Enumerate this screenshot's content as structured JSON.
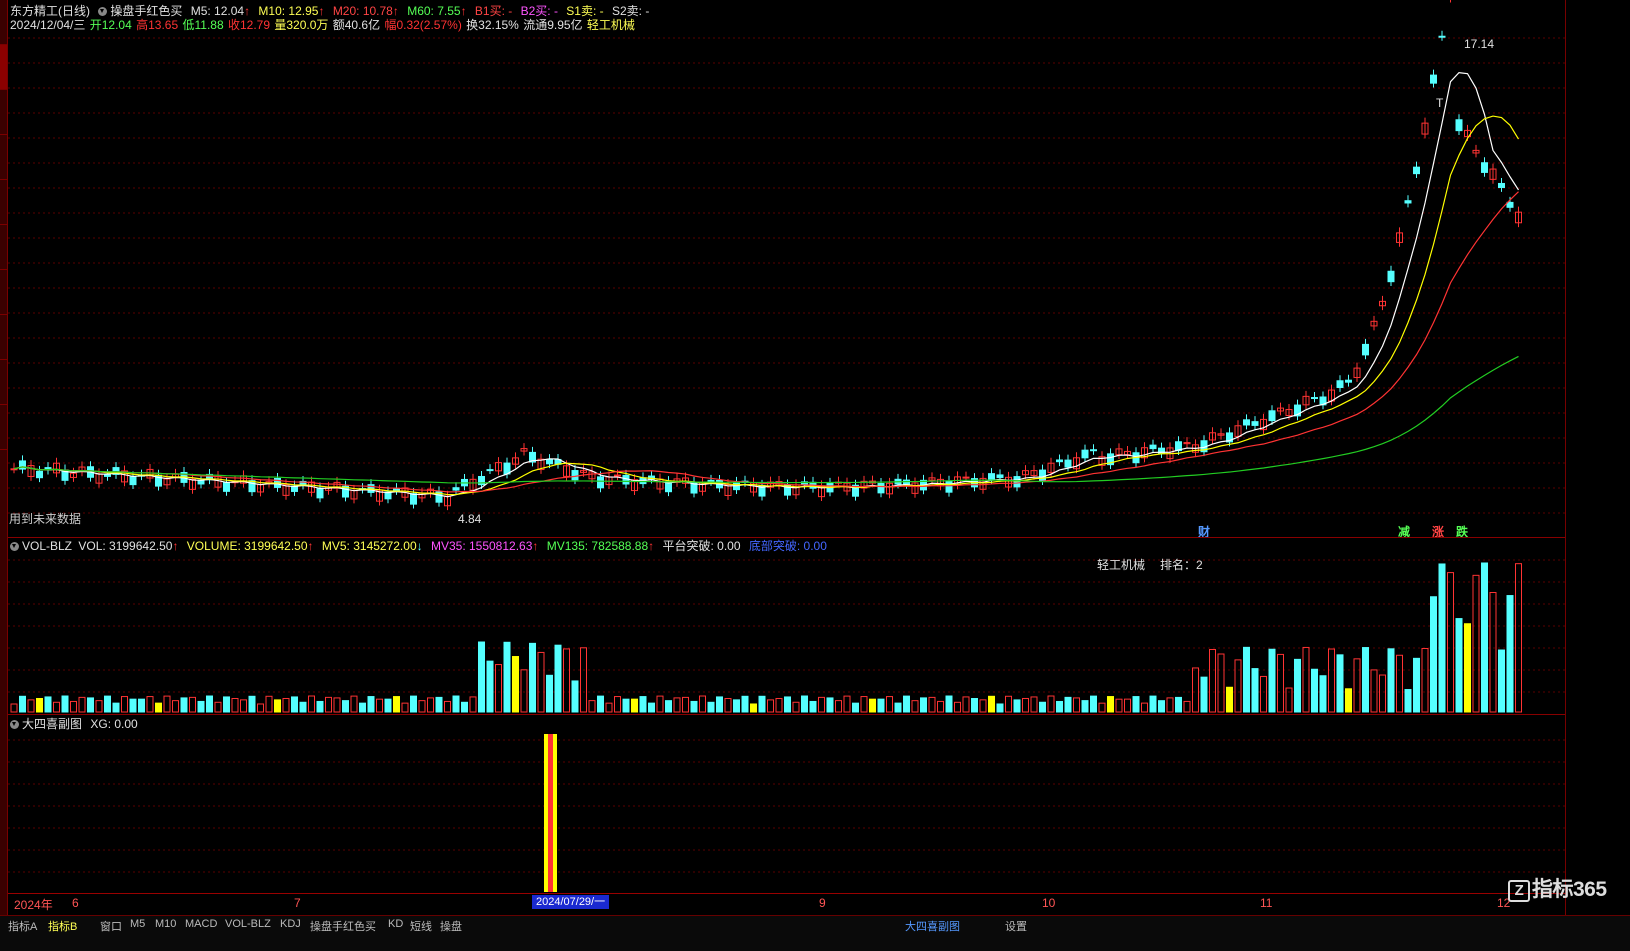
{
  "header": {
    "stock_name": "东方精工(日线)",
    "indicator": "操盘手红色买",
    "ma5": "M5: 12.04",
    "ma10": "M10: 12.95",
    "ma20": "M20: 10.78",
    "ma60": "M60: 7.55",
    "b1": "B1买: -",
    "b2": "B2买: -",
    "s1": "S1卖: -",
    "s2": "S2卖: -",
    "date": "2024/12/04/三",
    "open": "开12.04",
    "high": "高13.65",
    "low": "低11.88",
    "close": "收12.79",
    "volume": "量320.0万",
    "amount": "额40.6亿",
    "change": "幅0.32(2.57%)",
    "turnover": "换32.15%",
    "float_cap": "流通9.95亿",
    "industry": "轻工机械"
  },
  "price_chart": {
    "max_label": "17.14",
    "min_label": "4.84",
    "future_note": "用到未来数据",
    "event_labels": [
      "财",
      "减",
      "涨",
      "跌"
    ],
    "marker_T": "T"
  },
  "volume_panel": {
    "name": "VOL-BLZ",
    "vol": "VOL: 3199642.50",
    "volume": "VOLUME: 3199642.50",
    "mv5": "MV5: 3145272.00",
    "mv35": "MV35: 1550812.63",
    "mv135": "MV135: 782588.88",
    "platform": "平台突破: 0.00",
    "breakout": "底部突破: 0.00",
    "sector": "轻工机械",
    "rank": "排名：2"
  },
  "sub_panel": {
    "name": "大四喜副图",
    "xg": "XG: 0.00"
  },
  "axis": {
    "months": [
      "2024年",
      "6",
      "7",
      "9",
      "10",
      "11",
      "12"
    ],
    "cursor_date": "2024/07/29/一"
  },
  "logo": {
    "text": "指标365",
    "mark": "Z"
  },
  "tabs": [
    "指标A",
    "指标B",
    "窗口",
    "M5",
    "M10",
    "MACD",
    "VOL-BLZ",
    "KDJ",
    "操盘手红色买",
    "KD",
    "短线",
    "操盘",
    "大四喜副图",
    "设置"
  ],
  "colors": {
    "up": "#ff3333",
    "down": "#55ffff",
    "ma5": "#ffffff",
    "ma10": "#ffff00",
    "ma20": "#ff3333",
    "ma60": "#22cc22",
    "highlight": "#ffff00"
  }
}
